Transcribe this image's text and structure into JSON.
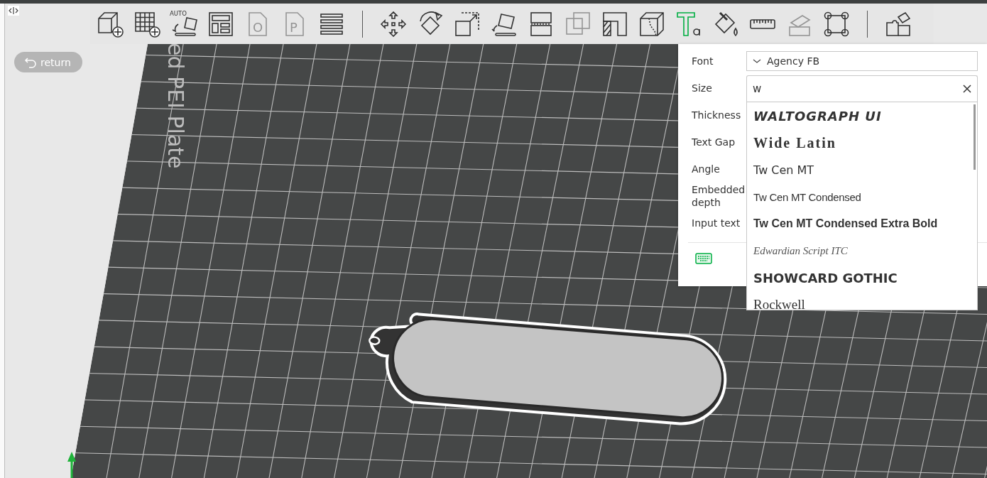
{
  "toolbar": {
    "tools": [
      {
        "kind": "add-object",
        "disabled": false,
        "selected": false
      },
      {
        "kind": "add-plate",
        "disabled": false,
        "selected": false
      },
      {
        "kind": "auto-orient",
        "label": "AUTO",
        "disabled": false,
        "selected": false
      },
      {
        "kind": "arrange",
        "disabled": false,
        "selected": false
      },
      {
        "kind": "doc",
        "label": "O",
        "disabled": true,
        "selected": false
      },
      {
        "kind": "doc",
        "label": "P",
        "disabled": true,
        "selected": false
      },
      {
        "kind": "layers",
        "disabled": false,
        "selected": false
      },
      {
        "kind": "divider"
      },
      {
        "kind": "move",
        "disabled": false,
        "selected": false
      },
      {
        "kind": "rotate",
        "disabled": false,
        "selected": false
      },
      {
        "kind": "scale",
        "disabled": false,
        "selected": false
      },
      {
        "kind": "lay-flat",
        "disabled": false,
        "selected": false
      },
      {
        "kind": "cut",
        "disabled": false,
        "selected": false
      },
      {
        "kind": "boolean",
        "disabled": true,
        "selected": false
      },
      {
        "kind": "support",
        "disabled": false,
        "selected": false
      },
      {
        "kind": "seam",
        "disabled": false,
        "selected": false
      },
      {
        "kind": "text",
        "disabled": false,
        "selected": true
      },
      {
        "kind": "paint",
        "disabled": false,
        "selected": false
      },
      {
        "kind": "measure",
        "disabled": false,
        "selected": false
      },
      {
        "kind": "assemble",
        "disabled": true,
        "selected": false
      },
      {
        "kind": "brim-ears",
        "disabled": false,
        "selected": false
      },
      {
        "kind": "divider"
      },
      {
        "kind": "puzzle",
        "disabled": false,
        "selected": false
      }
    ]
  },
  "return_button": {
    "label": "return"
  },
  "plate": {
    "label": "ed PEI Plate"
  },
  "text_panel": {
    "rows": [
      {
        "label": "Font",
        "kind": "select",
        "value": "Agency FB"
      },
      {
        "label": "Size",
        "kind": "search",
        "value": "w"
      },
      {
        "label": "Thickness",
        "kind": "label"
      },
      {
        "label": "Text Gap",
        "kind": "label"
      },
      {
        "label": "Angle",
        "kind": "label"
      },
      {
        "label": "Embedded depth",
        "kind": "label"
      },
      {
        "label": "Input text",
        "kind": "label"
      }
    ],
    "font_options": [
      {
        "label": "WALTOGRAPH UI",
        "kind": "display"
      },
      {
        "label": "Wide Latin",
        "kind": "wide"
      },
      {
        "label": "Tw Cen MT",
        "kind": "plain"
      },
      {
        "label": "Tw Cen MT Condensed",
        "kind": "condensed"
      },
      {
        "label": "Tw Cen MT Condensed Extra Bold",
        "kind": "condensed-bold"
      },
      {
        "label": "Edwardian Script ITC",
        "kind": "script"
      },
      {
        "label": "SHOWCARD GOTHIC",
        "kind": "heavy"
      },
      {
        "label": "Rockwell",
        "kind": "serif"
      }
    ]
  }
}
